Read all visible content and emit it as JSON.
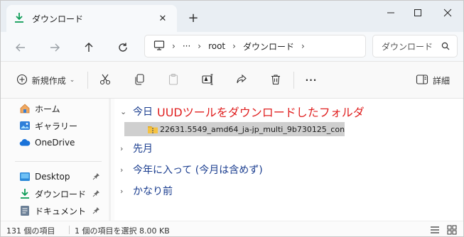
{
  "tab": {
    "title": "ダウンロード",
    "close": "✕",
    "new_tab": "+"
  },
  "window": {
    "minimize": "—",
    "maximize": "☐",
    "close": "✕"
  },
  "address": {
    "crumbs": [
      "root",
      "ダウンロード"
    ],
    "ellipsis": "···",
    "search_placeholder": "ダウンロード"
  },
  "commands": {
    "new_label": "新規作成",
    "more": "···",
    "details_label": "詳細"
  },
  "sidebar": {
    "items": [
      {
        "label": "ホーム",
        "icon": "home-icon"
      },
      {
        "label": "ギャラリー",
        "icon": "gallery-icon"
      },
      {
        "label": "OneDrive",
        "icon": "cloud-icon"
      },
      {
        "label": "Desktop",
        "icon": "desktop-icon"
      },
      {
        "label": "ダウンロード",
        "icon": "download-icon"
      },
      {
        "label": "ドキュメント",
        "icon": "document-icon"
      }
    ]
  },
  "content": {
    "today": {
      "label": "今日",
      "note": "UUDツールをダウンロードしたフォルダ"
    },
    "file": {
      "name": "22631.5549_amd64_ja-jp_multi_9b730125_con..."
    },
    "groups": [
      "先月",
      "今年に入って (今月は含めず)",
      "かなり前"
    ]
  },
  "status": {
    "count": "131 個の項目",
    "selection": "1 個の項目を選択  8.00 KB"
  },
  "colors": {
    "accent": "#0f6cbd",
    "annotation": "#e02020",
    "group_text": "#1a3d8f"
  }
}
